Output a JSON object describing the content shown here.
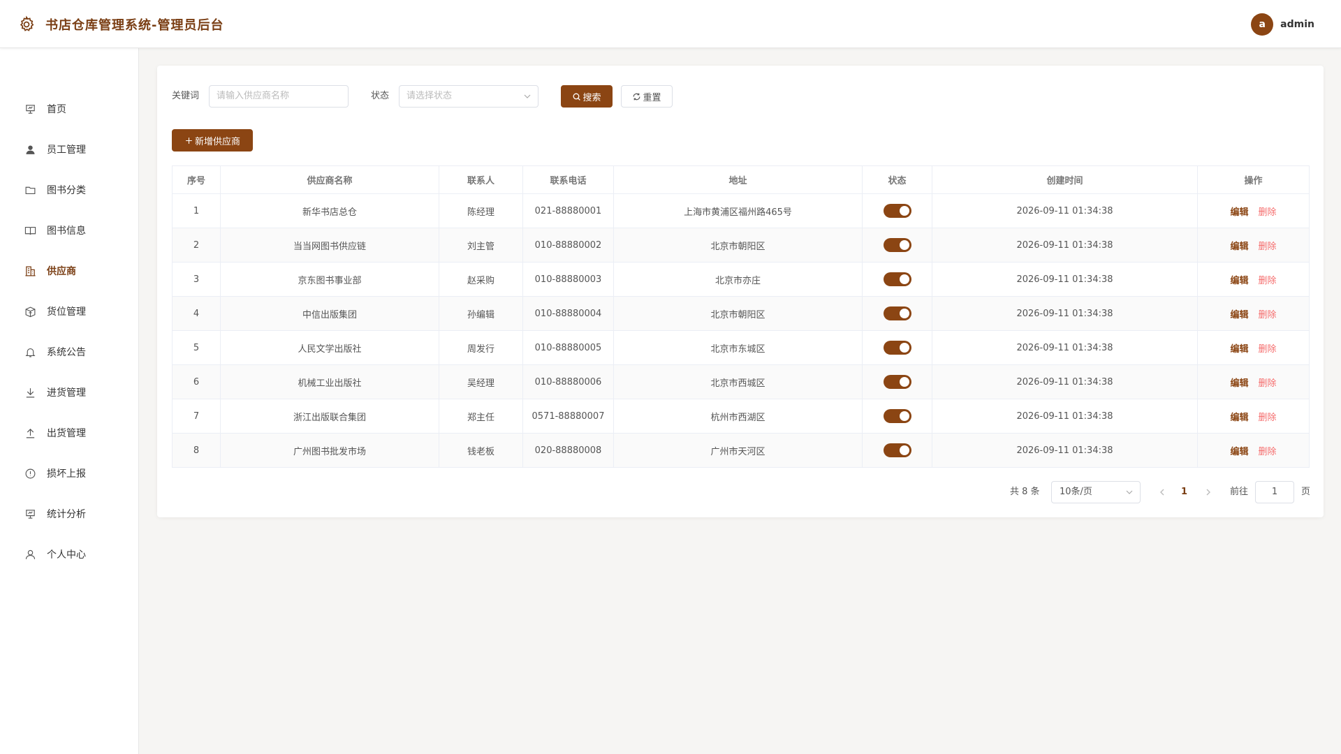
{
  "header": {
    "title": "书店仓库管理系统-管理员后台",
    "avatar_letter": "a",
    "username": "admin"
  },
  "sidebar": {
    "items": [
      {
        "label": "首页",
        "icon": "presentation-board-icon",
        "active": false
      },
      {
        "label": "员工管理",
        "icon": "user-icon",
        "active": false
      },
      {
        "label": "图书分类",
        "icon": "folder-icon",
        "active": false
      },
      {
        "label": "图书信息",
        "icon": "book-icon",
        "active": false
      },
      {
        "label": "供应商",
        "icon": "building-icon",
        "active": true
      },
      {
        "label": "货位管理",
        "icon": "box-icon",
        "active": false
      },
      {
        "label": "系统公告",
        "icon": "bell-icon",
        "active": false
      },
      {
        "label": "进货管理",
        "icon": "download-icon",
        "active": false
      },
      {
        "label": "出货管理",
        "icon": "upload-icon",
        "active": false
      },
      {
        "label": "损坏上报",
        "icon": "warning-circle-icon",
        "active": false
      },
      {
        "label": "统计分析",
        "icon": "chart-board-icon",
        "active": false
      },
      {
        "label": "个人中心",
        "icon": "user-outline-icon",
        "active": false
      }
    ]
  },
  "filters": {
    "keyword_label": "关键词",
    "keyword_placeholder": "请输入供应商名称",
    "status_label": "状态",
    "status_placeholder": "请选择状态",
    "search_label": "搜索",
    "reset_label": "重置"
  },
  "add_button_label": "新增供应商",
  "table": {
    "columns": [
      "序号",
      "供应商名称",
      "联系人",
      "联系电话",
      "地址",
      "状态",
      "创建时间",
      "操作"
    ],
    "rows": [
      {
        "index": "1",
        "name": "新华书店总仓",
        "contact": "陈经理",
        "phone": "021-88880001",
        "address": "上海市黄浦区福州路465号",
        "enabled": true,
        "created": "2026-09-11 01:34:38"
      },
      {
        "index": "2",
        "name": "当当网图书供应链",
        "contact": "刘主管",
        "phone": "010-88880002",
        "address": "北京市朝阳区",
        "enabled": true,
        "created": "2026-09-11 01:34:38"
      },
      {
        "index": "3",
        "name": "京东图书事业部",
        "contact": "赵采购",
        "phone": "010-88880003",
        "address": "北京市亦庄",
        "enabled": true,
        "created": "2026-09-11 01:34:38"
      },
      {
        "index": "4",
        "name": "中信出版集团",
        "contact": "孙编辑",
        "phone": "010-88880004",
        "address": "北京市朝阳区",
        "enabled": true,
        "created": "2026-09-11 01:34:38"
      },
      {
        "index": "5",
        "name": "人民文学出版社",
        "contact": "周发行",
        "phone": "010-88880005",
        "address": "北京市东城区",
        "enabled": true,
        "created": "2026-09-11 01:34:38"
      },
      {
        "index": "6",
        "name": "机械工业出版社",
        "contact": "吴经理",
        "phone": "010-88880006",
        "address": "北京市西城区",
        "enabled": true,
        "created": "2026-09-11 01:34:38"
      },
      {
        "index": "7",
        "name": "浙江出版联合集团",
        "contact": "郑主任",
        "phone": "0571-88880007",
        "address": "杭州市西湖区",
        "enabled": true,
        "created": "2026-09-11 01:34:38"
      },
      {
        "index": "8",
        "name": "广州图书批发市场",
        "contact": "钱老板",
        "phone": "020-88880008",
        "address": "广州市天河区",
        "enabled": true,
        "created": "2026-09-11 01:34:38"
      }
    ],
    "edit_label": "编辑",
    "delete_label": "删除"
  },
  "pagination": {
    "total_text": "共 8 条",
    "page_size": "10条/页",
    "current_page": "1",
    "goto_label": "前往",
    "goto_value": "1",
    "page_suffix": "页"
  },
  "colors": {
    "accent": "#8b4513",
    "danger": "#f56c6c"
  }
}
